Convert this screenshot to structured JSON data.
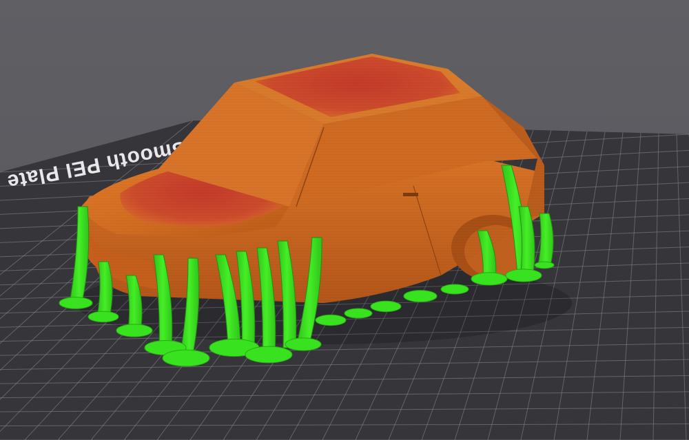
{
  "viewport": {
    "bed_label": "Smooth PEI Plate / High",
    "background_color": "#5b5b60",
    "bed_color": "#35353a",
    "grid_color": "#8a8a90",
    "model_color": "#d06a22",
    "top_surface_color": "#c9402c",
    "support_color": "#39e21e"
  }
}
